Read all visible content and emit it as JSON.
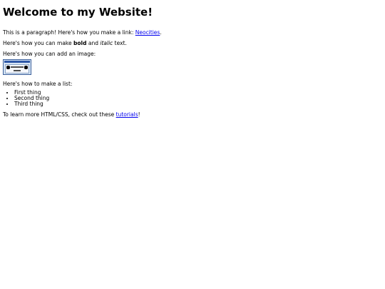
{
  "page": {
    "heading": "Welcome to my Website!",
    "intro": {
      "before": "This is a paragraph! Here's how you make a link: ",
      "link": "Neocities",
      "after": "."
    },
    "formatting": {
      "before": "Here's how you can make ",
      "bold": "bold",
      "middle": " and ",
      "italic": "italic",
      "after": " text."
    },
    "image_text": "Here's how you can add an image:",
    "list_intro": "Here's how to make a list:",
    "list_items": [
      "First thing",
      "Second thing",
      "Third thing"
    ],
    "closing": {
      "before": "To learn more HTML/CSS, check out these ",
      "link": "tutorials",
      "after": "!"
    }
  }
}
